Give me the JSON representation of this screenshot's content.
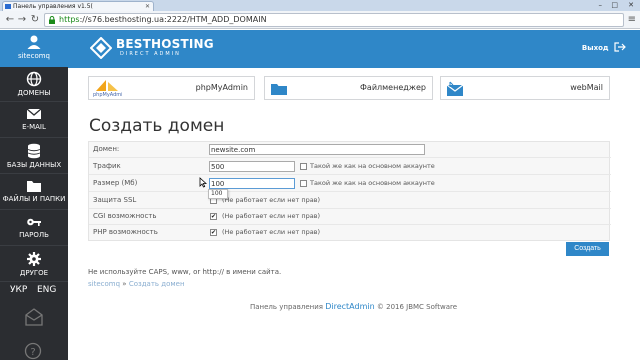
{
  "browser": {
    "tab_title": "Панель управления v1.5(",
    "url_scheme": "https",
    "url_rest": "://s76.besthosting.ua:2222/HTM_ADD_DOMAIN"
  },
  "sidebar": {
    "user": "sitecomq",
    "items": [
      {
        "label": "ДОМЕНЫ",
        "icon": "globe-icon"
      },
      {
        "label": "E-MAIL",
        "icon": "envelope-icon"
      },
      {
        "label": "БАЗЫ ДАННЫХ",
        "icon": "database-icon"
      },
      {
        "label": "ФАЙЛЫ И ПАПКИ",
        "icon": "folder-icon"
      },
      {
        "label": "ПАРОЛЬ",
        "icon": "key-icon"
      },
      {
        "label": "ДРУГОЕ",
        "icon": "gear-icon"
      }
    ],
    "lang_ukr": "УКР",
    "lang_eng": "ENG"
  },
  "header": {
    "brand": "BESTHOSTING",
    "brand_sub": "DIRECT ADMIN",
    "logout": "Выход"
  },
  "quick_links": [
    {
      "label": "phpMyAdmin",
      "icon": "phpmyadmin-icon"
    },
    {
      "label": "Файлменеджер",
      "icon": "folder-icon"
    },
    {
      "label": "webMail",
      "icon": "mail-icon"
    }
  ],
  "page_title": "Создать домен",
  "form": {
    "domain_label": "Домен:",
    "domain_value": "newsite.com",
    "traffic_label": "Трафик",
    "traffic_value": "500",
    "traffic_same": "Такой же как на основном аккаунте",
    "size_label": "Размер (Мб)",
    "size_value": "100",
    "size_same": "Такой же как на основном аккаунте",
    "size_dropdown": "100",
    "ssl_label": "Защита SSL",
    "ssl_note": "(Не работает если нет прав)",
    "cgi_label": "CGI возможность",
    "cgi_note": "(Не работает если нет прав)",
    "php_label": "PHP возможность",
    "php_note": "(Не работает если нет прав)",
    "submit": "Создать"
  },
  "note": "Не используйте CAPS, www, or http:// в имени сайта.",
  "breadcrumb": {
    "root": "sitecomq",
    "sep": "»",
    "current": "Создать домен"
  },
  "footer": {
    "prefix": "Панель управления",
    "product": "DirectAdmin",
    "suffix": "© 2016 JBMC Software"
  },
  "colors": {
    "accent": "#2f87c8",
    "sidebar": "#2b2d31"
  }
}
